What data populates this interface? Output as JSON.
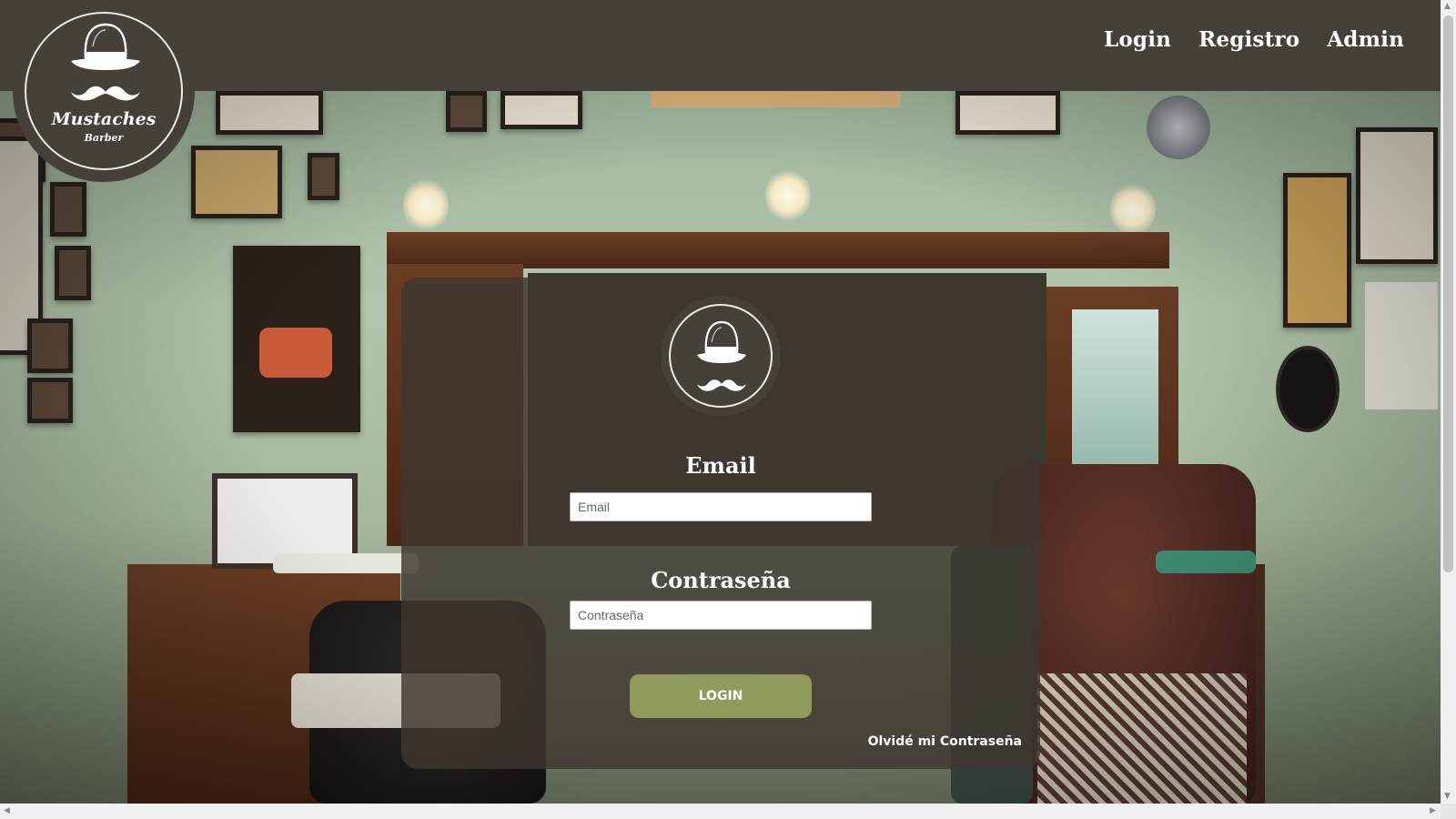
{
  "brand": {
    "name": "Mustaches",
    "subtitle": "Barber",
    "logo_icon": "bowler-hat-mustache-icon"
  },
  "nav": {
    "items": [
      {
        "label": "Login"
      },
      {
        "label": "Registro"
      },
      {
        "label": "Admin"
      }
    ]
  },
  "login_form": {
    "logo_icon": "bowler-hat-mustache-icon",
    "email_label": "Email",
    "email_placeholder": "Email",
    "email_value": "",
    "password_label": "Contraseña",
    "password_placeholder": "Contraseña",
    "password_value": "",
    "submit_label": "LOGIN",
    "forgot_label": "Olvidé mi Contraseña"
  },
  "colors": {
    "header_bg": "#46403a",
    "card_bg": "#3e3730",
    "button_bg": "#8f9a5c",
    "text": "#ffffff"
  }
}
